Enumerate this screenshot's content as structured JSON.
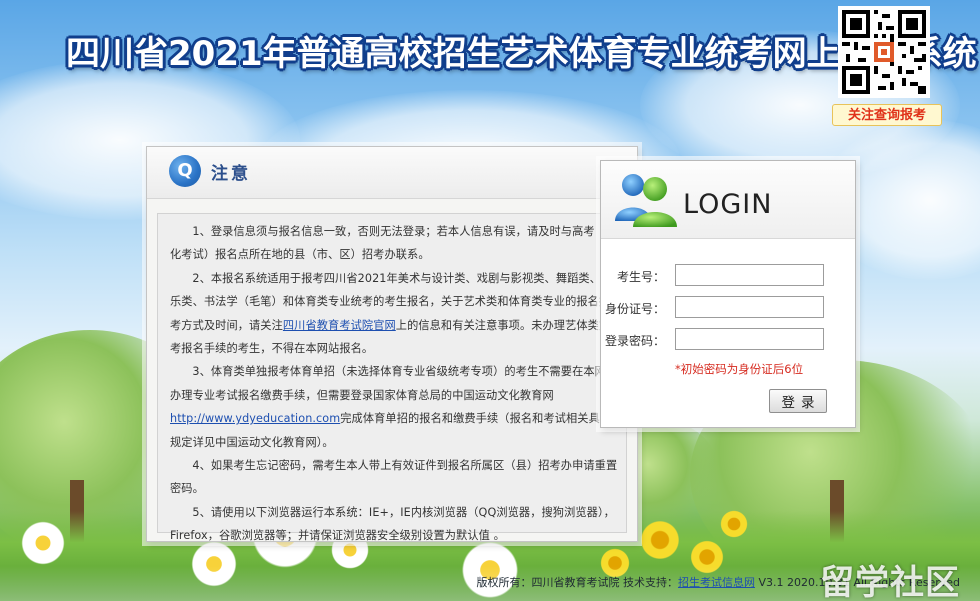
{
  "header": {
    "title": "四川省2021年普通高校招生艺术体育专业统考网上报名系统"
  },
  "qr": {
    "caption": "关注查询报考"
  },
  "notice": {
    "title": "注意",
    "q_glyph": "Q",
    "items": [
      "1、登录信息须与报名信息一致，否则无法登录；若本人信息有误，请及时与高考（文化考试）报名点所在地的县（市、区）招考办联系。",
      "3、体育类单独报考体育单招（未选择体育专业省级统考专项）的考生不需要在本网站办理专业考试报名缴费手续，但需要登录国家体育总局的中国运动文化教育网",
      "4、如果考生忘记密码，需考生本人带上有效证件到报名所属区（县）招考办申请重置密码。",
      "5、请使用以下浏览器运行本系统：IE+，IE内核浏览器（QQ浏览器，搜狗浏览器），Firefox，谷歌浏览器等；并请保证浏览器安全级别设置为默认值 。"
    ],
    "item2_before": "2、本报名系统适用于报考四川省2021年美术与设计类、戏剧与影视类、舞蹈类、音乐类、书法学（毛笔）和体育类专业统考的考生报名，关于艺术类和体育类专业的报名报考方式及时间，请关注",
    "item2_link": "四川省教育考试院官网",
    "item2_after": "上的信息和有关注意事项。未办理艺体类文考报名手续的考生，不得在本网站报名。",
    "item3_link": "http://www.ydyeducation.com",
    "item3_after": "完成体育单招的报名和缴费手续（报名和考试相关具体规定详见中国运动文化教育网）。"
  },
  "login": {
    "title": "LOGIN",
    "fields": [
      {
        "label": "考生号：",
        "value": ""
      },
      {
        "label": "身份证号：",
        "value": ""
      },
      {
        "label": "登录密码：",
        "value": ""
      }
    ],
    "hint": "*初始密码为身份证后6位",
    "submit_label": "登录"
  },
  "footer": {
    "copyright": "版权所有：四川省教育考试院 技术支持：",
    "support_link": "招生考试信息网",
    "version": " V3.1 2020.10.31 All Rights Reserved"
  },
  "watermark": "留学社区"
}
